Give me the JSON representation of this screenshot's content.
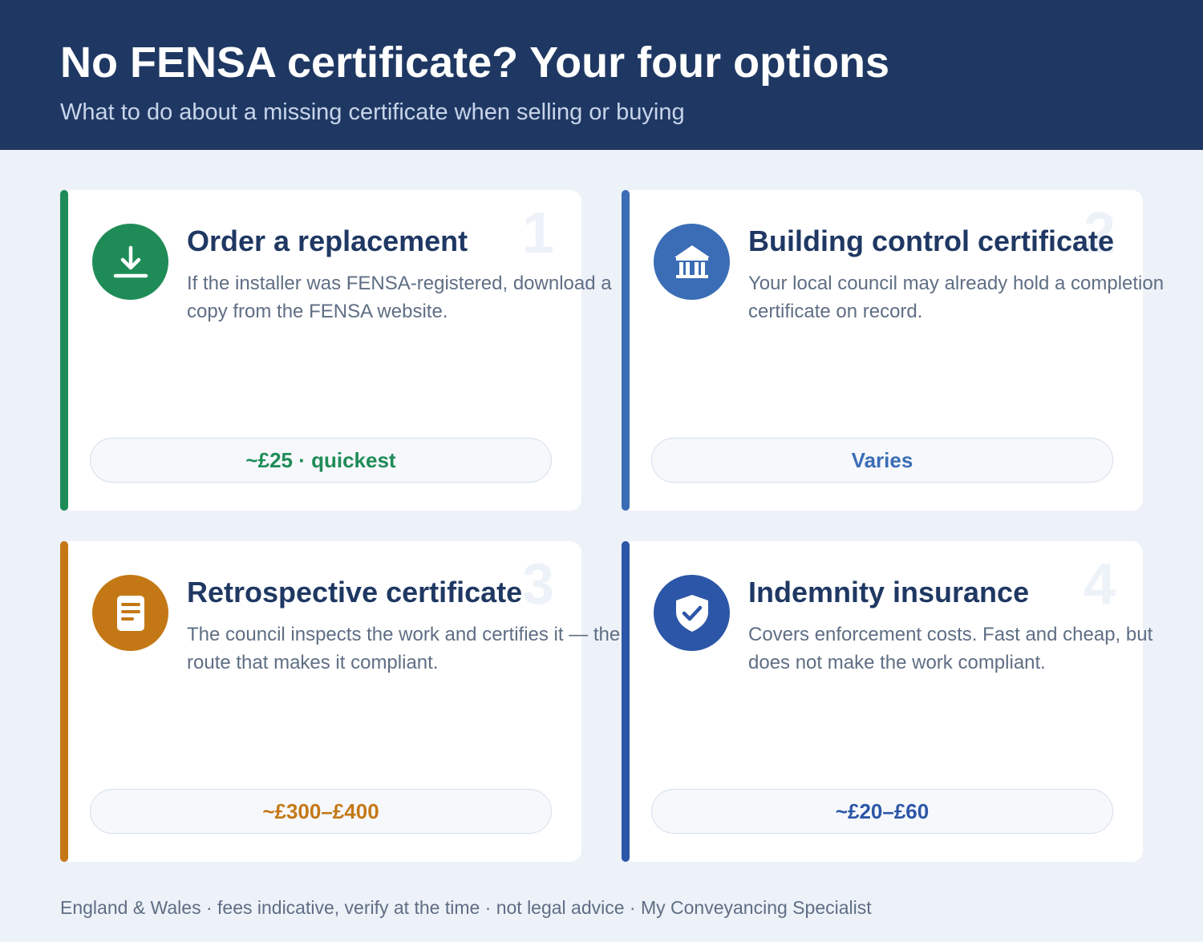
{
  "header": {
    "title": "No FENSA certificate? Your four options",
    "subtitle": "What to do about a missing certificate when selling or buying"
  },
  "cards": [
    {
      "number": "1",
      "title": "Order a replacement",
      "description": "If the installer was FENSA-registered, download a copy from the FENSA website.",
      "cost": "~£25 · quickest",
      "icon": "download-icon",
      "color": "#1f8c57"
    },
    {
      "number": "2",
      "title": "Building control certificate",
      "description": "Your local council may already hold a completion certificate on record.",
      "cost": "Varies",
      "icon": "building-icon",
      "color": "#3a6db5"
    },
    {
      "number": "3",
      "title": "Retrospective certificate",
      "description": "The council inspects the work and certifies it — the route that makes it compliant.",
      "cost": "~£300–£400",
      "icon": "document-icon",
      "color": "#c47815"
    },
    {
      "number": "4",
      "title": "Indemnity insurance",
      "description": "Covers enforcement costs. Fast and cheap, but does not make the work compliant.",
      "cost": "~£20–£60",
      "icon": "shield-check-icon",
      "color": "#2c56a7"
    }
  ],
  "footer": "England & Wales · fees indicative, verify at the time · not legal advice · My Conveyancing Specialist"
}
